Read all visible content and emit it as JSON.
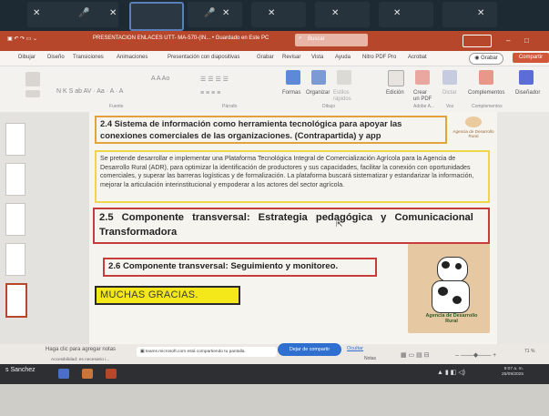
{
  "window": {
    "title": "PRESENTACION ENLACES UTT- MA-570-(IN... • Guardado en Este PC",
    "search_placeholder": "Buscar"
  },
  "ribbon": {
    "tabs": [
      "Dibujar",
      "Diseño",
      "Transiciones",
      "Animaciones",
      "Presentación con diapositivas",
      "Grabar",
      "Revisar",
      "Vista",
      "Ayuda",
      "Nitro PDF Pro",
      "Acrobat"
    ],
    "grabar_label": "Grabar",
    "compartir_label": "Compartir",
    "commands": [
      "Formas",
      "Organizar",
      "Estilos rápidos",
      "Edición",
      "Crear un PDF",
      "Dictar",
      "Complementos",
      "Diseñador"
    ],
    "groups": [
      "Fuente",
      "Párrafo",
      "Dibujo",
      "Adobe A...",
      "Voz",
      "Complementos"
    ]
  },
  "slide": {
    "heading_24": "2.4 Sistema de información como herramienta tecnológica para apoyar las conexiones comerciales de las organizaciones. (Contrapartida) y app",
    "paragraph": "Se pretende desarrollar e implementar una Plataforma Tecnológica Integral de Comercialización Agrícola para la Agencia de Desarrollo Rural (ADR), para optimizar la identificación de productores y sus capacidades, facilitar la conexión con oportunidades comerciales, y superar las barreras logísticas y de formalización. La plataforma buscará sistematizar y estandarizar la información, mejorar la articulación interinstitucional y empoderar a los actores del sector agrícola.",
    "heading_25": "2.5 Componente transversal: Estrategia pedagógica y Comunicacional Transformadora",
    "heading_26": "2.6 Componente transversal: Seguimiento y monitoreo.",
    "thanks": "MUCHAS GRACIAS.",
    "logo_top": "Agencia de Desarrollo Rural",
    "logo_cow": "Agencia de Desarrollo Rural"
  },
  "status": {
    "notes": "Haga clic para agregar notas",
    "sharing_message": "teams.microsoft.com está compartiendo tu pantalla.",
    "stop_sharing": "Dejar de compartir",
    "hide": "Ocultar",
    "accessibility": "Accesibilidad: es necesario i...",
    "notas": "Notas",
    "zoom": "71 %"
  },
  "taskbar": {
    "user": "s Sanchez",
    "time": "9:07 a. m.",
    "date": "25/09/2025"
  },
  "colors": {
    "powerpoint_red": "#b7472a",
    "box_orange": "#e2a23c",
    "box_yellow": "#ecd74a",
    "box_red": "#c83c3c",
    "highlight": "#f4e81a"
  }
}
